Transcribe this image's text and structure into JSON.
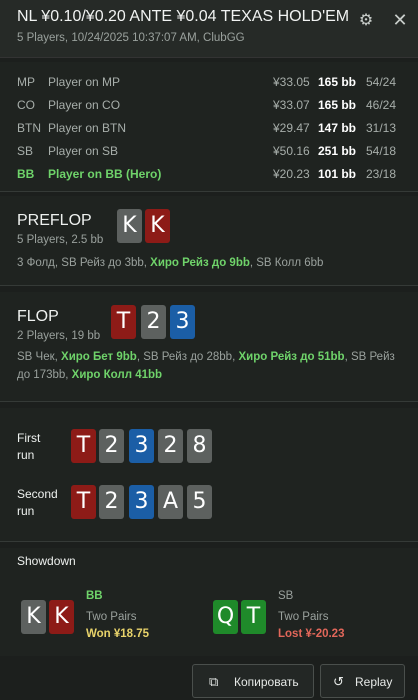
{
  "header": {
    "title": "NL ¥0.10/¥0.20 ANTE ¥0.04 TEXAS HOLD'EM",
    "subtitle": "5 Players, 10/24/2025 10:37:07 AM, ClubGG",
    "gear_icon": "gear-icon",
    "close_icon": "close-icon"
  },
  "players": [
    {
      "pos": "MP",
      "name": "Player on MP",
      "money": "¥33.05",
      "bb": "165 bb",
      "ratio": "54/24"
    },
    {
      "pos": "CO",
      "name": "Player on CO",
      "money": "¥33.07",
      "bb": "165 bb",
      "ratio": "46/24"
    },
    {
      "pos": "BTN",
      "name": "Player on BTN",
      "money": "¥29.47",
      "bb": "147 bb",
      "ratio": "31/13"
    },
    {
      "pos": "SB",
      "name": "Player on SB",
      "money": "¥50.16",
      "bb": "251 bb",
      "ratio": "54/18"
    },
    {
      "pos": "BB",
      "name": "Player on BB (Hero)",
      "money": "¥20.23",
      "bb": "101 bb",
      "ratio": "23/18"
    }
  ],
  "preflop": {
    "title": "PREFLOP",
    "sub": "5 Players, 2.5 bb",
    "cards": [
      "K",
      "K"
    ],
    "actions": [
      {
        "text": "3 Фолд, SB Рейз до 3bb, ",
        "hero": false
      },
      {
        "text": "Хиро Рейз до 9bb",
        "hero": true
      },
      {
        "text": ", SB Колл 6bb",
        "hero": false
      }
    ]
  },
  "flop": {
    "title": "FLOP",
    "sub": "2 Players, 19 bb",
    "cards": [
      "T",
      "2",
      "3"
    ],
    "actions": [
      {
        "text": "SB Чек, ",
        "hero": false
      },
      {
        "text": "Хиро Бет 9bb",
        "hero": true
      },
      {
        "text": ", SB Рейз до 28bb, ",
        "hero": false
      },
      {
        "text": "Хиро Рейз до 51bb",
        "hero": true
      },
      {
        "text": ", SB Рейз до 173bb, ",
        "hero": false
      },
      {
        "text": "Хиро Колл 41bb",
        "hero": true
      }
    ]
  },
  "runs": {
    "first_label_1": "First",
    "first_label_2": "run",
    "first_cards": [
      "T",
      "2",
      "3",
      "2",
      "8"
    ],
    "second_label_1": "Second",
    "second_label_2": "run",
    "second_cards": [
      "T",
      "2",
      "3",
      "A",
      "5"
    ]
  },
  "showdown": {
    "title": "Showdown",
    "hero": {
      "cards": [
        "K",
        "K"
      ],
      "name": "BB",
      "hand": "Two Pairs",
      "result": "Won ¥18.75"
    },
    "villain": {
      "cards": [
        "Q",
        "T"
      ],
      "name": "SB",
      "hand": "Two Pairs",
      "result": "Lost ¥-20.23"
    }
  },
  "buttons": {
    "copy_label": "Копировать",
    "copy_icon": "copy-icon",
    "replay_label": "Replay",
    "replay_icon": "replay-icon"
  },
  "colors": {
    "hero_green": "#6fd36a",
    "card_red": "#8d1b17",
    "card_blue": "#1b5ea6",
    "card_gray": "#5d615f",
    "card_green": "#1f8a2a",
    "won": "#e8d36a",
    "lost": "#e2675a"
  }
}
